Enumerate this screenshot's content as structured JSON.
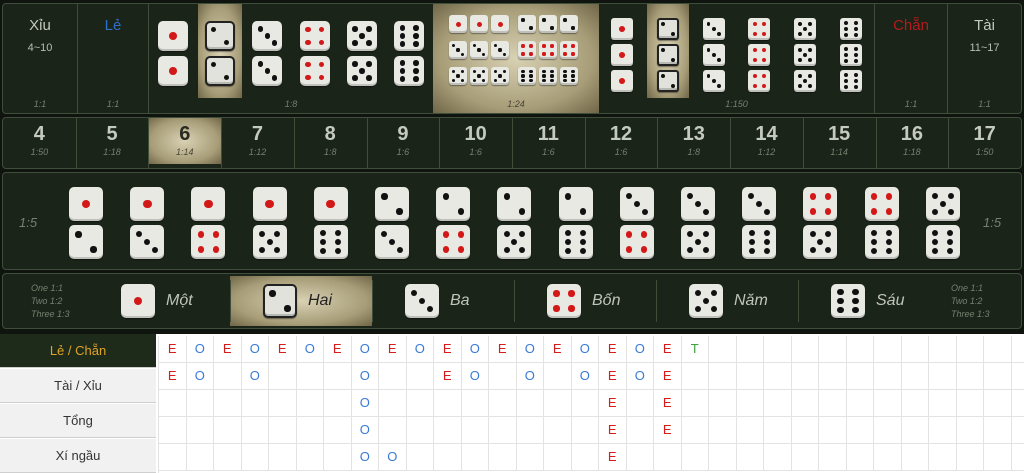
{
  "top_bets": {
    "xiu": {
      "title": "Xỉu",
      "range": "4~10",
      "odds": "1:1"
    },
    "le": {
      "title": "Lẻ",
      "odds": "1:1"
    },
    "doubles": {
      "faces": [
        1,
        2,
        3,
        4,
        5,
        6
      ],
      "highlighted_face": 2,
      "odds": "1:8"
    },
    "any_triple": {
      "odds": "1:24",
      "highlighted": true
    },
    "triples": {
      "faces": [
        1,
        2,
        3,
        4,
        5,
        6
      ],
      "highlighted_face": 2,
      "odds": "1:150"
    },
    "chan": {
      "title": "Chẵn",
      "odds": "1:1"
    },
    "tai": {
      "title": "Tài",
      "range": "11~17",
      "odds": "1:1"
    },
    "colors": {
      "le_title": "#2f6fc7",
      "chan_title": "#b21c1c",
      "highlight": "#d8d1b3"
    }
  },
  "totals": [
    {
      "num": "4",
      "odds": "1:50"
    },
    {
      "num": "5",
      "odds": "1:18"
    },
    {
      "num": "6",
      "odds": "1:14",
      "highlighted": true
    },
    {
      "num": "7",
      "odds": "1:12"
    },
    {
      "num": "8",
      "odds": "1:8"
    },
    {
      "num": "9",
      "odds": "1:6"
    },
    {
      "num": "10",
      "odds": "1:6"
    },
    {
      "num": "11",
      "odds": "1:6"
    },
    {
      "num": "12",
      "odds": "1:6"
    },
    {
      "num": "13",
      "odds": "1:8"
    },
    {
      "num": "14",
      "odds": "1:12"
    },
    {
      "num": "15",
      "odds": "1:14"
    },
    {
      "num": "16",
      "odds": "1:18"
    },
    {
      "num": "17",
      "odds": "1:50"
    }
  ],
  "combos": {
    "odds_left": "1:5",
    "odds_right": "1:5",
    "pairs": [
      [
        1,
        2
      ],
      [
        1,
        3
      ],
      [
        1,
        4
      ],
      [
        1,
        5
      ],
      [
        1,
        6
      ],
      [
        2,
        3
      ],
      [
        2,
        4
      ],
      [
        2,
        5
      ],
      [
        2,
        6
      ],
      [
        3,
        4
      ],
      [
        3,
        5
      ],
      [
        3,
        6
      ],
      [
        4,
        5
      ],
      [
        4,
        6
      ],
      [
        5,
        6
      ]
    ]
  },
  "singles": {
    "odds_left": [
      "One 1:1",
      "Two 1:2",
      "Three 1:3"
    ],
    "odds_right": [
      "One 1:1",
      "Two 1:2",
      "Three 1:3"
    ],
    "faces": [
      {
        "face": 1,
        "label": "Một"
      },
      {
        "face": 2,
        "label": "Hai",
        "highlighted": true
      },
      {
        "face": 3,
        "label": "Ba"
      },
      {
        "face": 4,
        "label": "Bốn"
      },
      {
        "face": 5,
        "label": "Năm"
      },
      {
        "face": 6,
        "label": "Sáu"
      }
    ]
  },
  "ledger": {
    "tabs": [
      {
        "label": "Lẻ / Chẵn",
        "active": true
      },
      {
        "label": "Tài / Xỉu"
      },
      {
        "label": "Tổng"
      },
      {
        "label": "Xí ngầu"
      }
    ],
    "grid_rows": [
      [
        "E",
        "O",
        "E",
        "O",
        "E",
        "O",
        "E",
        "O",
        "E",
        "O",
        "E",
        "O",
        "E",
        "O",
        "E",
        "O",
        "E",
        "O",
        "E",
        "T",
        "",
        "",
        "",
        "",
        "",
        "",
        "",
        "",
        "",
        "",
        "",
        ""
      ],
      [
        "E",
        "O",
        "",
        "O",
        "",
        "",
        "",
        "O",
        "",
        "",
        "E",
        "O",
        "",
        "O",
        "",
        "O",
        "E",
        "O",
        "E",
        "",
        "",
        "",
        "",
        "",
        "",
        "",
        "",
        "",
        "",
        "",
        "",
        ""
      ],
      [
        "",
        "",
        "",
        "",
        "",
        "",
        "",
        "O",
        "",
        "",
        "",
        "",
        "",
        "",
        "",
        "",
        "E",
        "",
        "E",
        "",
        "",
        "",
        "",
        "",
        "",
        "",
        "",
        "",
        "",
        "",
        "",
        ""
      ],
      [
        "",
        "",
        "",
        "",
        "",
        "",
        "",
        "O",
        "",
        "",
        "",
        "",
        "",
        "",
        "",
        "",
        "E",
        "",
        "E",
        "",
        "",
        "",
        "",
        "",
        "",
        "",
        "",
        "",
        "",
        "",
        "",
        ""
      ],
      [
        "",
        "",
        "",
        "",
        "",
        "",
        "",
        "O",
        "O",
        "",
        "",
        "",
        "",
        "",
        "",
        "",
        "E",
        "",
        "",
        "",
        "",
        "",
        "",
        "",
        "",
        "",
        "",
        "",
        "",
        "",
        "",
        ""
      ]
    ]
  }
}
